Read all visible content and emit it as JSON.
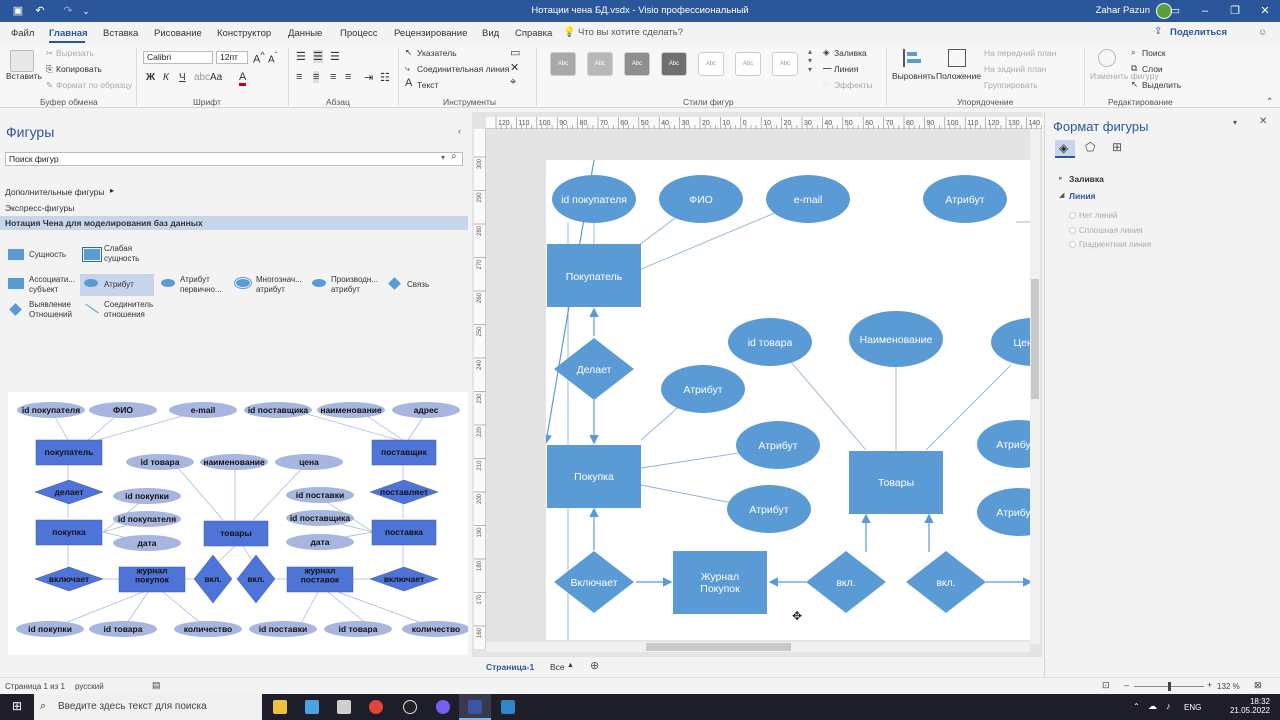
{
  "titlebar": {
    "title": "Нотации чена БД.vsdx  -  Visio профессиональный",
    "user": "Zahar Pazun",
    "colors": {
      "bar": "#2b579a",
      "accent": "#2b579a"
    }
  },
  "menu": {
    "items": [
      "Файл",
      "Главная",
      "Вставка",
      "Рисование",
      "Конструктор",
      "Данные",
      "Процесс",
      "Рецензирование",
      "Вид",
      "Справка"
    ],
    "tell_me": "Что вы хотите сделать?",
    "share": "Поделиться"
  },
  "ribbon": {
    "clipboard": {
      "paste": "Вставить",
      "cut": "Вырезать",
      "copy": "Копировать",
      "format_painter": "Формат по образцу",
      "label": "Буфер обмена"
    },
    "font": {
      "name": "Calibri",
      "size": "12пт",
      "label": "Шрифт"
    },
    "paragraph": {
      "label": "Абзац"
    },
    "tools": {
      "pointer": "Указатель",
      "connector": "Соединительная линия",
      "text": "Текст",
      "label": "Инструменты"
    },
    "styles": {
      "label": "Стили фигур",
      "sample": "Abc",
      "fill": "Заливка",
      "line": "Линия",
      "effects": "Эффекты"
    },
    "arrange": {
      "align": "Выровнять",
      "position": "Положение",
      "bring_front": "На передний план",
      "send_back": "На задний план",
      "group": "Группировать",
      "label": "Упорядочение"
    },
    "editing": {
      "change_shape": "Изменить фигуру",
      "find": "Поиск",
      "layers": "Слои",
      "select": "Выделить",
      "label": "Редактирование"
    }
  },
  "shapes_pane": {
    "title": "Фигуры",
    "search_placeholder": "Поиск фигур",
    "more_shapes": "Дополнительные фигуры",
    "quick_shapes": "Экспресс-фигуры",
    "stencil_name": "Нотация Чена для моделирования баз данных",
    "stencil_items": [
      {
        "label": "Сущность"
      },
      {
        "label": "Слабая\nсущность"
      },
      {
        "label": "Ассоциати...\nсубъект"
      },
      {
        "label": "Атрибут"
      },
      {
        "label": "Атрибут\nпервично..."
      },
      {
        "label": "Многознач...\nатрибут"
      },
      {
        "label": "Производн...\nатрибут"
      },
      {
        "label": "Связь"
      },
      {
        "label": "Выявление\nОтношений"
      },
      {
        "label": "Соединитель\nотношения"
      }
    ]
  },
  "preview": {
    "attrs_top": [
      "id покупателя",
      "ФИО",
      "e-mail",
      "id поставщика",
      "наименование",
      "адрес"
    ],
    "entities": [
      "покупатель",
      "покупка",
      "товары",
      "поставщик",
      "поставка",
      "журнал\nпокупок",
      "журнал\nпоставок"
    ],
    "relations": [
      "делает",
      "включает",
      "вкл.",
      "вкл.",
      "поставляет",
      "включает"
    ],
    "attrs_mid": [
      "id товара",
      "наименование",
      "цена",
      "id покупки",
      "id покупателя",
      "дата",
      "id поставки",
      "id поставщика",
      "дата"
    ],
    "attrs_bottom": [
      "id покупки",
      "id товара",
      "количество",
      "id поставки",
      "id товара",
      "количество"
    ]
  },
  "diagram": {
    "attributes": [
      "id покупателя",
      "ФИО",
      "e-mail",
      "Атрибут",
      "id товара",
      "Наименование",
      "Цена",
      "Атрибут",
      "Атрибут",
      "Атрибут",
      "Атрибут",
      "Атрибут"
    ],
    "entities": [
      "Покупатель",
      "Покупка",
      "Товары",
      "Журнал\nПокупок"
    ],
    "relations": [
      "Делает",
      "Включает",
      "вкл.",
      "вкл."
    ],
    "colors": {
      "shape": "#5b9bd5",
      "text": "#ffffff",
      "line": "#7fa8d1"
    }
  },
  "rulers": {
    "h": [
      "120",
      "110",
      "100",
      "90",
      "80",
      "70",
      "60",
      "50",
      "40",
      "30",
      "20",
      "10",
      "0",
      "10",
      "20",
      "30",
      "40",
      "50",
      "60",
      "70",
      "80",
      "90",
      "100",
      "110",
      "120",
      "130",
      "140"
    ],
    "v": [
      "300",
      "290",
      "280",
      "270",
      "260",
      "250",
      "240",
      "230",
      "220",
      "210",
      "200",
      "190",
      "180",
      "170",
      "160"
    ]
  },
  "page_tabs": {
    "current": "Страница-1",
    "all": "Все"
  },
  "format_pane": {
    "title": "Формат фигуры",
    "fill": "Заливка",
    "line": "Линия",
    "options": [
      "Нет линий",
      "Сплошная линия",
      "Градиентная линия"
    ]
  },
  "statusbar": {
    "page": "Страница 1 из 1",
    "language": "русский",
    "zoom": "132 %"
  },
  "taskbar": {
    "search": "Введите здесь текст для поиска",
    "lang": "ENG",
    "time": "18:32",
    "date": "21.05.2022"
  }
}
